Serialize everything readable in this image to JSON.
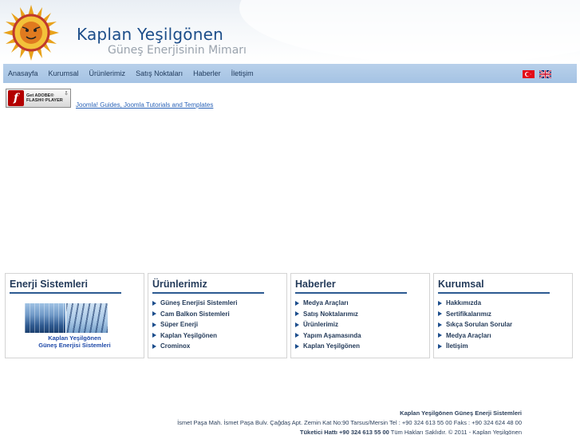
{
  "header": {
    "title": "Kaplan Yeşilgönen",
    "subtitle": "Güneş Enerjisinin Mimarı",
    "logo_icon": "sun-tiger-logo"
  },
  "nav": {
    "items": [
      "Anasayfa",
      "Kurumsal",
      "Ürünlerimiz",
      "Satış Noktaları",
      "Haberler",
      "İletişim"
    ],
    "flags": [
      "turkey-flag-icon",
      "uk-flag-icon"
    ]
  },
  "flash": {
    "line1": "Get ADOBE®",
    "line2": "FLASH® PLAYER",
    "link": "Joomla! Guides, Joomla Tutorials and Templates"
  },
  "boxes": {
    "energy": {
      "title": "Enerji Sistemleri",
      "caption_line1": "Kaplan Yeşilgönen",
      "caption_line2": "Güneş Enerjisi Sistemleri"
    },
    "products": {
      "title": "Ürünlerimiz",
      "items": [
        "Güneş Enerjisi Sistemleri",
        "Cam Balkon Sistemleri",
        "Süper Enerji",
        "Kaplan Yeşilgönen",
        "Crominox"
      ]
    },
    "news": {
      "title": "Haberler",
      "items": [
        "Medya Araçları",
        "Satış Noktalarımız",
        "Ürünlerimiz",
        "Yapım Aşamasında",
        "Kaplan Yeşilgönen"
      ]
    },
    "corporate": {
      "title": "Kurumsal",
      "items": [
        "Hakkımızda",
        "Sertifikalarımız",
        "Sıkça Sorulan Sorular",
        "Medya Araçları",
        "İletişim"
      ]
    }
  },
  "footer": {
    "company": "Kaplan Yeşilgönen Güneş Enerji Sistemleri",
    "address": "İsmet Paşa Mah. İsmet Paşa Bulv. Çağdaş Apt. Zemin Kat No:90 Tarsus/Mersin Tel : +90 324 613 55 00 Faks : +90 324 624 48 00",
    "hotline_label": "Tüketici Hattı +90 324 613 55 00",
    "rights": "Tüm Hakları Saklıdır. © 2011 - Kaplan Yeşilgönen"
  },
  "colors": {
    "nav_bg": "#a5c3e4",
    "title": "#1d4e8a",
    "box_rule": "#2c5a91",
    "link": "#2a63b8"
  }
}
